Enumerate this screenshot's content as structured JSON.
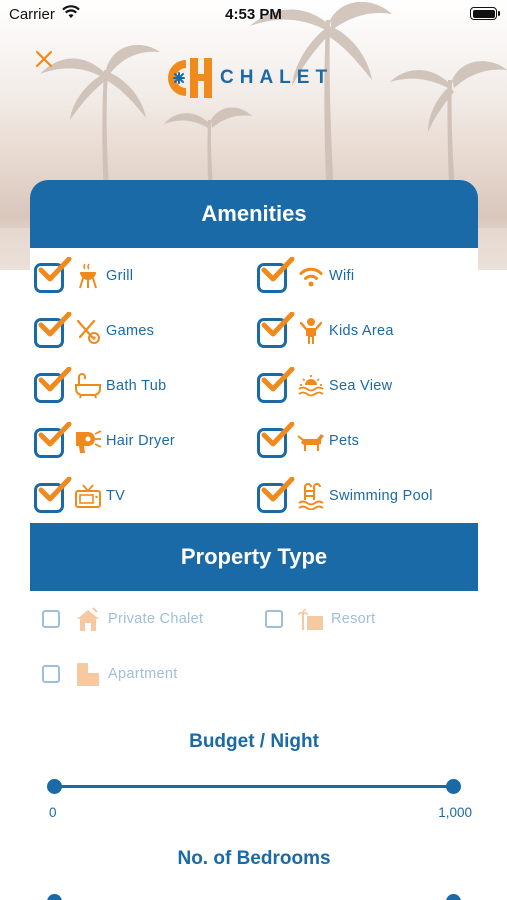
{
  "status_bar": {
    "carrier": "Carrier",
    "time": "4:53 PM"
  },
  "brand": {
    "name": "CHALET"
  },
  "colors": {
    "primary": "#1a6aa8",
    "accent": "#f08a1c",
    "muted": "#9dbfdc"
  },
  "amenities": {
    "title": "Amenities",
    "items": [
      {
        "label": "Grill",
        "icon": "grill-icon",
        "checked": true
      },
      {
        "label": "Wifi",
        "icon": "wifi-icon",
        "checked": true
      },
      {
        "label": "Games",
        "icon": "games-icon",
        "checked": true
      },
      {
        "label": "Kids Area",
        "icon": "kids-area-icon",
        "checked": true
      },
      {
        "label": "Bath Tub",
        "icon": "bath-tub-icon",
        "checked": true
      },
      {
        "label": "Sea View",
        "icon": "sea-view-icon",
        "checked": true
      },
      {
        "label": "Hair Dryer",
        "icon": "hair-dryer-icon",
        "checked": true
      },
      {
        "label": "Pets",
        "icon": "pets-icon",
        "checked": true
      },
      {
        "label": "TV",
        "icon": "tv-icon",
        "checked": true
      },
      {
        "label": "Swimming Pool",
        "icon": "swimming-pool-icon",
        "checked": true
      }
    ]
  },
  "property_type": {
    "title": "Property Type",
    "items": [
      {
        "label": "Private Chalet",
        "icon": "chalet-icon",
        "checked": false
      },
      {
        "label": "Resort",
        "icon": "resort-icon",
        "checked": false
      },
      {
        "label": "Apartment",
        "icon": "apartment-icon",
        "checked": false
      }
    ]
  },
  "budget": {
    "title": "Budget / Night",
    "min": "0",
    "max": "1,000"
  },
  "bedrooms": {
    "title": "No. of Bedrooms"
  }
}
